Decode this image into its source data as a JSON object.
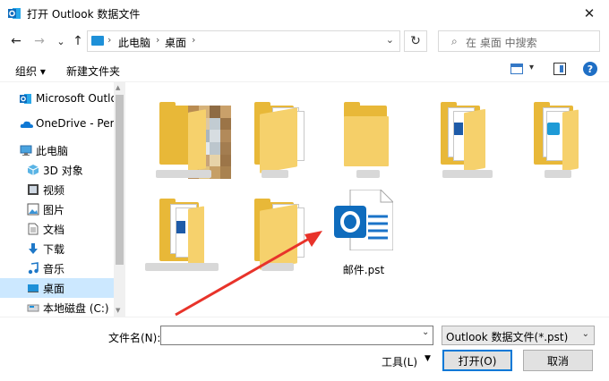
{
  "window": {
    "title": "打开 Outlook 数据文件",
    "close_symbol": "✕"
  },
  "nav": {
    "back": "←",
    "forward": "→",
    "recent": "⌄",
    "up": "↑",
    "breadcrumbs": [
      "此电脑",
      "桌面"
    ],
    "crumb_sep": "›",
    "addr_dropdown": "⌄",
    "refresh": "↻",
    "search_placeholder": "在 桌面 中搜索"
  },
  "toolbar": {
    "organize": "组织 ▾",
    "new_folder": "新建文件夹",
    "view_drop": "▾",
    "help": "?"
  },
  "sidebar": {
    "items": [
      {
        "label": "Microsoft Outlook",
        "icon": "outlook-icon"
      },
      {
        "label": "OneDrive - Personal",
        "icon": "onedrive-icon"
      },
      {
        "label": "此电脑",
        "icon": "computer-icon"
      },
      {
        "label": "3D 对象",
        "icon": "cube-icon"
      },
      {
        "label": "视频",
        "icon": "video-icon"
      },
      {
        "label": "图片",
        "icon": "picture-icon"
      },
      {
        "label": "文档",
        "icon": "document-icon"
      },
      {
        "label": "下载",
        "icon": "download-icon"
      },
      {
        "label": "音乐",
        "icon": "music-icon"
      },
      {
        "label": "桌面",
        "icon": "desktop-icon"
      },
      {
        "label": "本地磁盘 (C:)",
        "icon": "drive-icon"
      }
    ],
    "scroll_up": "▲",
    "scroll_down": "▼"
  },
  "content": {
    "files": [
      {
        "name": "邮件.pst",
        "icon": "outlook-pst-icon"
      }
    ]
  },
  "bottom": {
    "filename_label": "文件名(N):",
    "filename_value": "",
    "filename_drop": "⌄",
    "filetype": "Outlook 数据文件(*.pst)",
    "filetype_drop": "⌄",
    "tools": "工具(L)",
    "tools_arrow": "▼",
    "open": "打开(O)",
    "cancel": "取消"
  },
  "colors": {
    "accent": "#0078d7",
    "selection": "#cce8ff",
    "folder": "#f6d16c",
    "outlook_blue": "#0f6cbd",
    "arrow": "#e8332a"
  }
}
